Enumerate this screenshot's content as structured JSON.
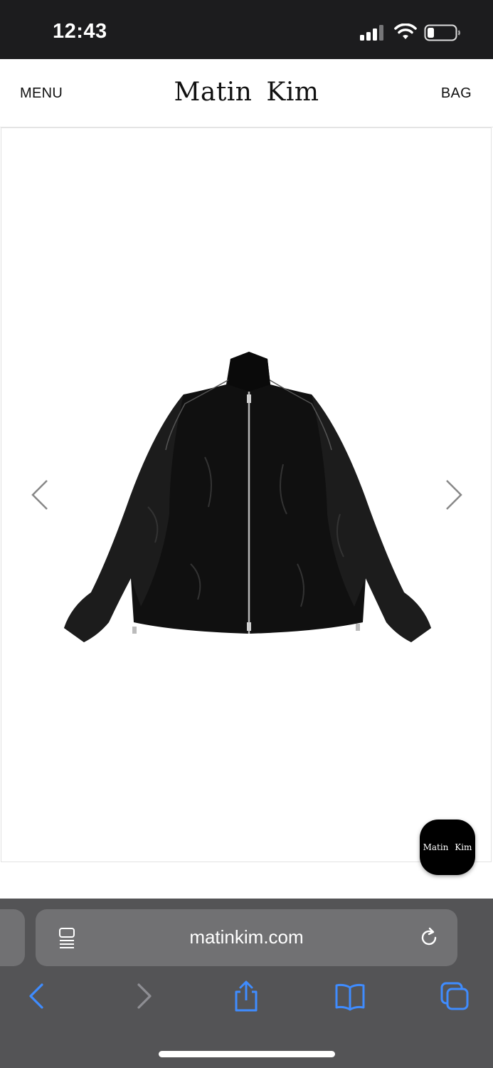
{
  "status_bar": {
    "time": "12:43",
    "icons": [
      "signal-icon",
      "wifi-icon",
      "battery-icon"
    ]
  },
  "header": {
    "menu_label": "MENU",
    "brand": "Matin Kim",
    "bag_label": "BAG"
  },
  "gallery": {
    "image_subject": "black-zip-up-jacket",
    "icons": [
      "chevron-left-icon",
      "chevron-right-icon"
    ]
  },
  "chat": {
    "label": "Matin Kim"
  },
  "browser": {
    "url": "matinkim.com",
    "icons": [
      "reader-icon",
      "reload-icon",
      "back-icon",
      "forward-icon",
      "share-icon",
      "bookmarks-icon",
      "tabs-icon"
    ],
    "accent_color": "#3f8cff",
    "disabled_color": "#8e8e93"
  }
}
